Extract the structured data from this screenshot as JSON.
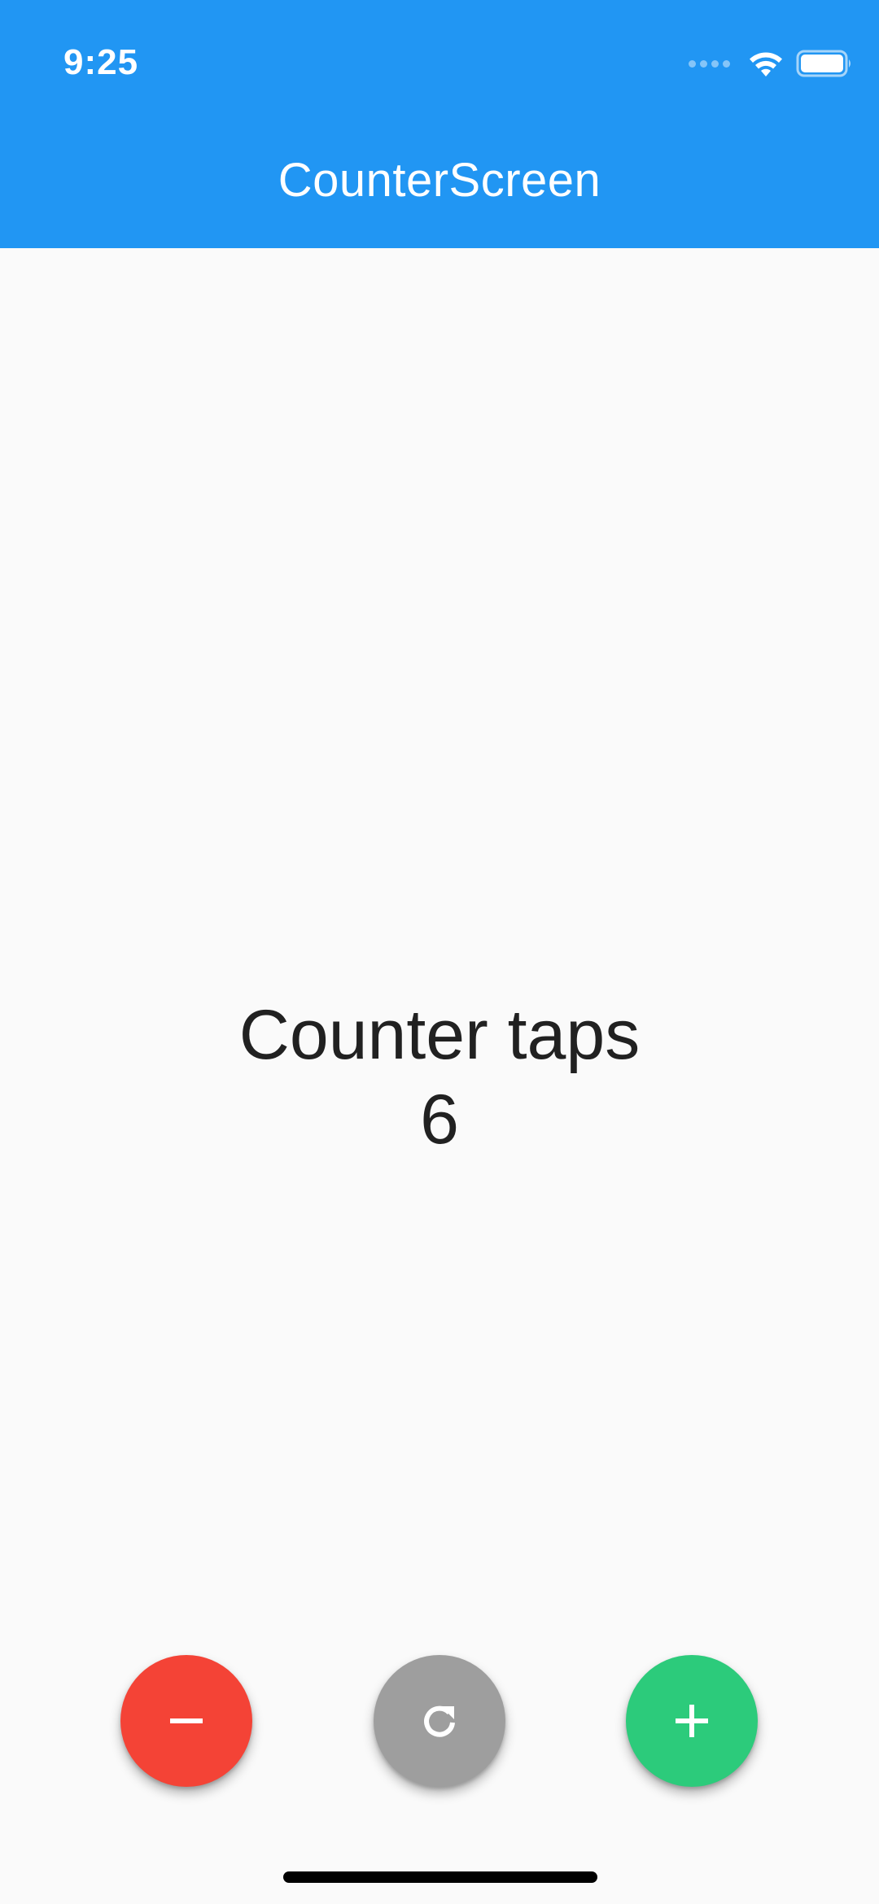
{
  "status_bar": {
    "time": "9:25",
    "icons": [
      "signal-icon",
      "wifi-icon",
      "battery-icon"
    ]
  },
  "app_bar": {
    "title": "CounterScreen",
    "background_color": "#2196f3"
  },
  "counter": {
    "label": "Counter taps",
    "value": "6"
  },
  "actions": {
    "decrement": {
      "icon": "minus-icon",
      "color": "#f44336"
    },
    "reset": {
      "icon": "refresh-icon",
      "color": "#9e9e9e"
    },
    "increment": {
      "icon": "plus-icon",
      "color": "#2ccb7b"
    }
  }
}
